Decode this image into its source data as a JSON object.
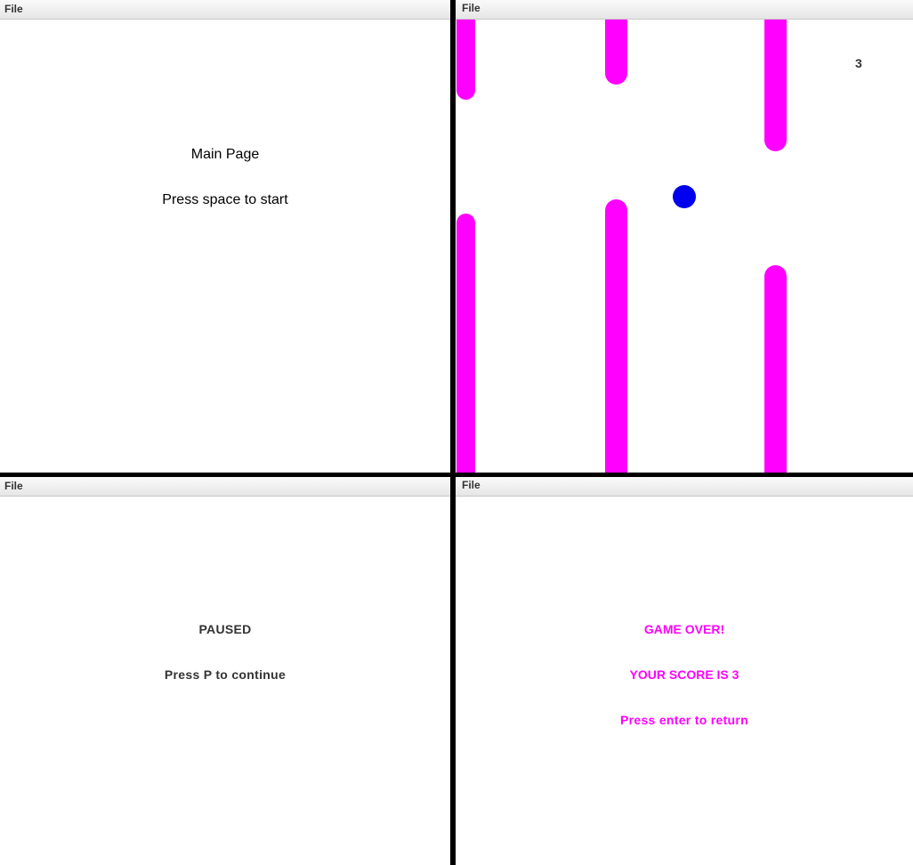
{
  "panels": {
    "main": {
      "menu_label": "File",
      "title": "Main Page",
      "hint": "Press space to start"
    },
    "game": {
      "menu_label": "File",
      "score": "3",
      "pipe_color": "#ff00ff",
      "ball_color": "#0000ee"
    },
    "paused": {
      "menu_label": "File",
      "title": "PAUSED",
      "hint": "Press P to continue"
    },
    "game_over": {
      "menu_label": "File",
      "title": "GAME OVER!",
      "score_text": "YOUR SCORE IS 3",
      "hint": "Press enter to return",
      "text_color": "#ff00ff"
    }
  }
}
